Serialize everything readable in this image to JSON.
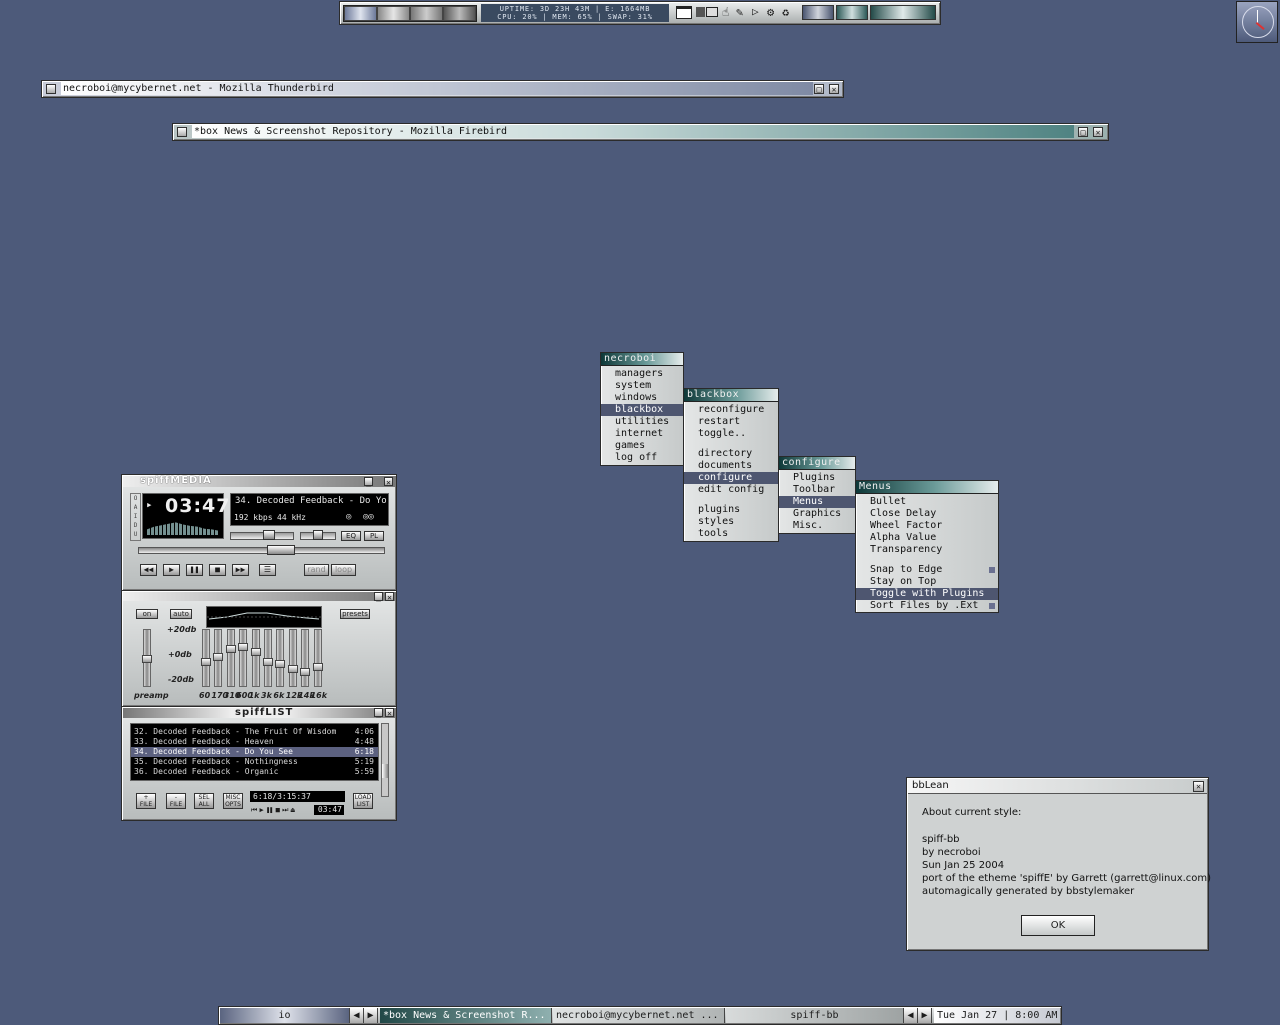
{
  "top_toolbar": {
    "line1": "UPTIME: 3D 23H 43M  |  E: 1664MB",
    "line2": "CPU: 20%  |  MEM: 65%  |  SWAP: 31%"
  },
  "windows": {
    "thunderbird": {
      "title": "necroboi@mycybernet.net - Mozilla Thunderbird"
    },
    "firebird": {
      "title": "*box News & Screenshot Repository - Mozilla Firebird"
    }
  },
  "menus": {
    "root": {
      "title": "necroboi",
      "items": [
        "managers",
        "system",
        "windows",
        "blackbox",
        "utilities",
        "internet",
        "games",
        "log off"
      ]
    },
    "blackbox": {
      "title": "blackbox",
      "items": [
        "reconfigure",
        "restart",
        "toggle..",
        "directory",
        "documents",
        "configure",
        "edit config",
        "plugins",
        "styles",
        "tools"
      ]
    },
    "configure": {
      "title": "configure",
      "items": [
        "Plugins",
        "Toolbar",
        "Menus",
        "Graphics",
        "Misc."
      ]
    },
    "menus_sub": {
      "title": "Menus",
      "items": [
        "Bullet",
        "Close Delay",
        "Wheel Factor",
        "Alpha Value",
        "Transparency",
        "Snap to Edge",
        "Stay on Top",
        "Toggle with Plugins",
        "Sort Files by .Ext"
      ]
    }
  },
  "player": {
    "title": "spiffMEDIA",
    "time": "03:47",
    "track": "34. Decoded Feedback - Do Yo",
    "kbps": "192 kbps",
    "khz": "44 kHz",
    "eq_btn": "EQ",
    "pl_btn": "PL",
    "rand": "rand",
    "loop": "loop",
    "stereo_letters": "O A I D U"
  },
  "eq": {
    "on": "on",
    "auto": "auto",
    "presets": "presets",
    "db_top": "+20db",
    "db_mid": "+0db",
    "db_bot": "-20db",
    "preamp": "preamp",
    "bands": [
      "60",
      "170",
      "310",
      "600",
      "1k",
      "3k",
      "6k",
      "12k",
      "14k",
      "16k"
    ],
    "levels": [
      0.55,
      0.45,
      0.3,
      0.25,
      0.35,
      0.55,
      0.6,
      0.7,
      0.75,
      0.65
    ],
    "preamp_level": 0.5
  },
  "playlist": {
    "title": "spiffLIST",
    "rows": [
      {
        "name": "32. Decoded Feedback - The Fruit Of Wisdom",
        "time": "4:06"
      },
      {
        "name": "33. Decoded Feedback - Heaven",
        "time": "4:48"
      },
      {
        "name": "34. Decoded Feedback - Do You See",
        "time": "6:18"
      },
      {
        "name": "35. Decoded Feedback - Nothingness",
        "time": "5:19"
      },
      {
        "name": "36. Decoded Feedback - Organic",
        "time": "5:59"
      }
    ],
    "selected_index": 2,
    "btn_add": [
      "+",
      "FILE"
    ],
    "btn_rem": [
      "-",
      "FILE"
    ],
    "btn_sel": [
      "SEL",
      "ALL"
    ],
    "btn_misc": [
      "MISC",
      "OPTS"
    ],
    "btn_load": [
      "LOAD",
      "LIST"
    ],
    "total": "6:18/3:15:37",
    "mini_time": "03:47"
  },
  "dialog": {
    "title": "bbLean",
    "heading": "About current style:",
    "lines": [
      "spiff-bb",
      "by necroboi",
      "Sun Jan 25 2004",
      "port of the etheme 'spiffE' by Garrett (garrett@linux.com)",
      "automagically generated by bbstylemaker"
    ],
    "ok": "OK"
  },
  "taskbar": {
    "workspace": "io",
    "tasks": [
      "*box News & Screenshot R...",
      "necroboi@mycybernet.net ..."
    ],
    "style": "spiff-bb",
    "clock": "Tue Jan 27  |  8:00 AM"
  },
  "colors": {
    "desktop": "#4d5a7a",
    "menu_title": "#2e5d5b",
    "highlight": "#4e5670"
  }
}
